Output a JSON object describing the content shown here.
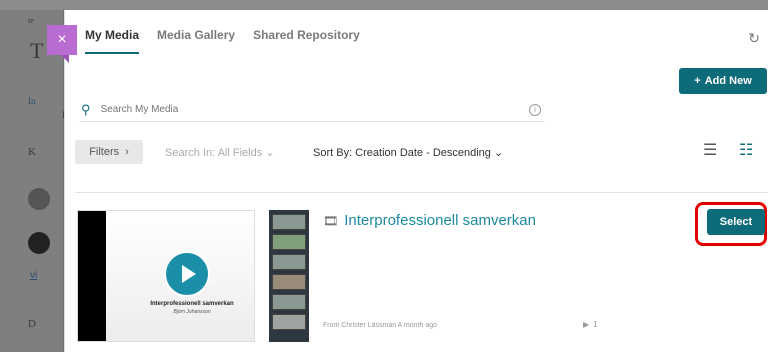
{
  "background": {
    "fragments": [
      "te",
      "T",
      "In",
      "K",
      "D",
      "L"
    ],
    "link": "vi"
  },
  "modal": {
    "close_label": "×",
    "tabs": [
      {
        "label": "My Media",
        "active": true
      },
      {
        "label": "Media Gallery",
        "active": false
      },
      {
        "label": "Shared Repository",
        "active": false
      }
    ],
    "refresh_icon": "refresh-icon",
    "add_new_label": "Add New",
    "search": {
      "placeholder": "Search My Media",
      "info_icon": "i"
    },
    "filters_label": "Filters",
    "search_in_label": "Search In: All Fields",
    "sort_by_label": "Sort By: Creation Date - Descending",
    "entry": {
      "title": "Interprofessionell samverkan",
      "meta": "From Christer Lässman A month ago",
      "plays": "1",
      "select_label": "Select",
      "thumb_caption": "Interprofessionell samverkan",
      "thumb_author": "Björn Johansson"
    }
  },
  "colors": {
    "accent": "#0e6b7a",
    "title_link": "#1d8aa0",
    "close": "#b86bd1",
    "highlight": "#e00000"
  }
}
